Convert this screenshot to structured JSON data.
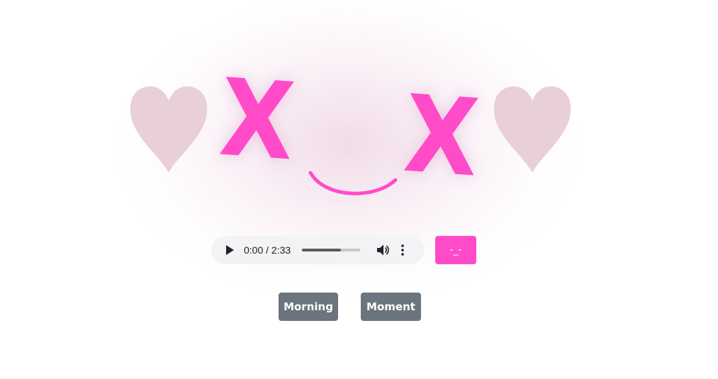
{
  "face": {
    "left_eye": "X",
    "right_eye": "X",
    "heart_color": "#e9d0d6",
    "accent_color": "#ff4bc8"
  },
  "audio": {
    "time_display": "0:00 / 2:33",
    "progress_fraction": 0.67,
    "icons": [
      "play-icon",
      "volume-icon",
      "more-options-icon"
    ]
  },
  "face_button": {
    "label": "-_-"
  },
  "buttons": {
    "morning_label": "Morning",
    "moment_label": "Moment",
    "color": "#6c757d"
  }
}
